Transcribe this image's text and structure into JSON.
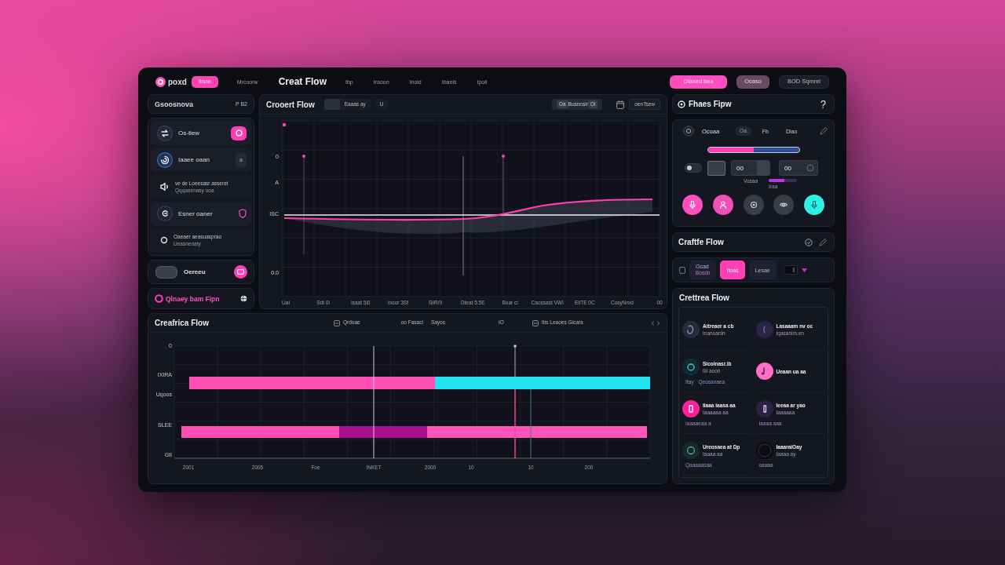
{
  "top_bar": {
    "brand": "poxd",
    "badge": "Ibsne",
    "nav_before": [
      "Mrcoorw"
    ],
    "title": "Creat Flow",
    "nav_after": [
      "Ibp",
      "Iraoon",
      "Inoid",
      "Ibanis",
      "Ipoil"
    ],
    "actions": [
      {
        "label": "Dlaxed bea",
        "kind": "primary"
      },
      {
        "label": "Ocaso",
        "kind": "secondary"
      },
      {
        "label": "BOD Sqmrel",
        "kind": "ghost"
      }
    ]
  },
  "sidebar": {
    "header": {
      "title": "Gsoosnova",
      "meta": "P B2"
    },
    "items": [
      {
        "kind": "action",
        "title": "Os-tiew"
      },
      {
        "kind": "badge",
        "title": "Iaaee oaan",
        "badge": "a"
      },
      {
        "kind": "note",
        "title": "ve de Loeesasr asseret",
        "subtitle": "Qqqaeenasy ooa"
      },
      {
        "kind": "flag",
        "title": "Esner oaner"
      },
      {
        "kind": "note",
        "title": "Oaeaer aeasuasprao",
        "subtitle": "Ueasnenaty"
      }
    ],
    "toggle_panel": {
      "label": "Oereeu"
    },
    "footer_link": {
      "label": "Qlnaey bam Fipn"
    }
  },
  "main_chart": {
    "title": "Crooert Flow",
    "filter": "Eaaas ay",
    "filter_value": "U",
    "range": {
      "prefix": "Oa",
      "label": "Busnnsir",
      "suffix": "Oi"
    },
    "export": "oenTsew",
    "y_labels": [
      "0",
      "A",
      "ISC",
      "0.0"
    ],
    "x_labels": [
      "Uai",
      "Sdt 0i",
      "Isaat 5i0",
      "Inoor 3Sf",
      "SiiR/9",
      "Oteat 5.5E",
      "Boar ci",
      "Caossast VWI",
      "EiiTE 0C",
      "CosyNrod",
      "00"
    ]
  },
  "timeline": {
    "title": "Creafrica Flow",
    "tools": [
      {
        "kind": "icon",
        "label": "Qrdoae"
      },
      {
        "kind": "text",
        "label": "oo Fasaci"
      },
      {
        "kind": "text",
        "label": "Sayos"
      },
      {
        "kind": "text",
        "label": "IO"
      },
      {
        "kind": "icon",
        "label": "Ibs Leaoes Gicara"
      }
    ],
    "y_labels": [
      "0",
      "IXIRA",
      "Uqoos",
      "SLEE",
      "GII"
    ],
    "x_labels": [
      "2001",
      "2005",
      "Foe",
      "INKET",
      "2000",
      "10",
      "10",
      "200"
    ]
  },
  "flow_panel": {
    "title": "Fhaes Fipw"
  },
  "controls": {
    "label": "Ocoaa",
    "chip": "Oa",
    "value": "Fb",
    "mode": "Diao",
    "slider": {
      "level": 0.5
    },
    "switch": {
      "on": false
    },
    "fields": [
      "00",
      "00"
    ],
    "captions": [
      "Vosaa",
      "Iraa"
    ],
    "meter": {
      "level": 0.55
    },
    "round_buttons": [
      {
        "color": "#ff4fbf"
      },
      {
        "color": "#f24fb8"
      },
      {
        "color": "#3a3c46"
      },
      {
        "color": "#3a3c46"
      },
      {
        "color": "#2ff0e6"
      }
    ]
  },
  "section": {
    "title": "Craftfe Flow"
  },
  "tabs": [
    {
      "label": "Ocad",
      "note": "Bosdn",
      "selected": false
    },
    {
      "label": "Itoas",
      "selected": true
    },
    {
      "label": "Lesae",
      "selected": false
    }
  ],
  "people": {
    "title": "Crettrea Flow",
    "items": [
      {
        "name": "Aitreaer a cb",
        "detail": "Inanuanln",
        "color": "#262b3a"
      },
      {
        "name": "Lasaaam nv oc",
        "detail": "Iqasanim.en",
        "color": "#2b2545"
      },
      {
        "name": "Sicolnasr.ib",
        "detail": "Iiii aoon",
        "notes": [
          "Itay",
          "Qeosanaea"
        ],
        "color": "#14292f"
      },
      {
        "name": "Ueaan ua aa",
        "color": "#ff6ec7"
      },
      {
        "name": "Iiaaa iaasa aa",
        "detail": "Iaaaaaa aa",
        "notes": [
          "Iaaaaeaa a"
        ],
        "color": "#ff1f9a"
      },
      {
        "name": "Ieeaa ar yao",
        "detail": "Iaaaaaa",
        "notes": [
          "Iaaaa aaa"
        ],
        "color": "#2a2244"
      },
      {
        "name": "Ureosaea at Dp",
        "detail": "Iaaaa aa",
        "notes": [
          "Qaaaaasaa"
        ],
        "color": "#17292e"
      },
      {
        "name": "IaaaraiOay",
        "detail": "Iaaaa ay",
        "notes": [
          "oaaaa"
        ],
        "color": "#0b0b10"
      }
    ]
  }
}
